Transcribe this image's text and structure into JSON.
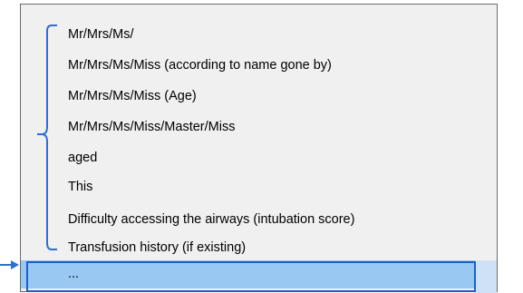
{
  "list": {
    "items": [
      {
        "label": "Mr/Mrs/Ms/"
      },
      {
        "label": "Mr/Mrs/Ms/Miss (according to name gone by)"
      },
      {
        "label": "Mr/Mrs/Ms/Miss (Age)"
      },
      {
        "label": "Mr/Mrs/Ms/Miss/Master/Miss"
      },
      {
        "label": "aged"
      },
      {
        "label": "This"
      },
      {
        "label": "Difficulty accessing the airways (intubation score)"
      },
      {
        "label": "Transfusion history (if existing)"
      }
    ],
    "selected_label": "..."
  },
  "colors": {
    "list_background": "#f0f0f0",
    "selection_fill": "#99c9f3",
    "selection_border": "#1f5fbf",
    "annotation_blue": "#2f6fd0"
  },
  "icons": {
    "bracket": "curly-brace-annotation-icon",
    "pointer": "arrow-right-annotation-icon"
  }
}
